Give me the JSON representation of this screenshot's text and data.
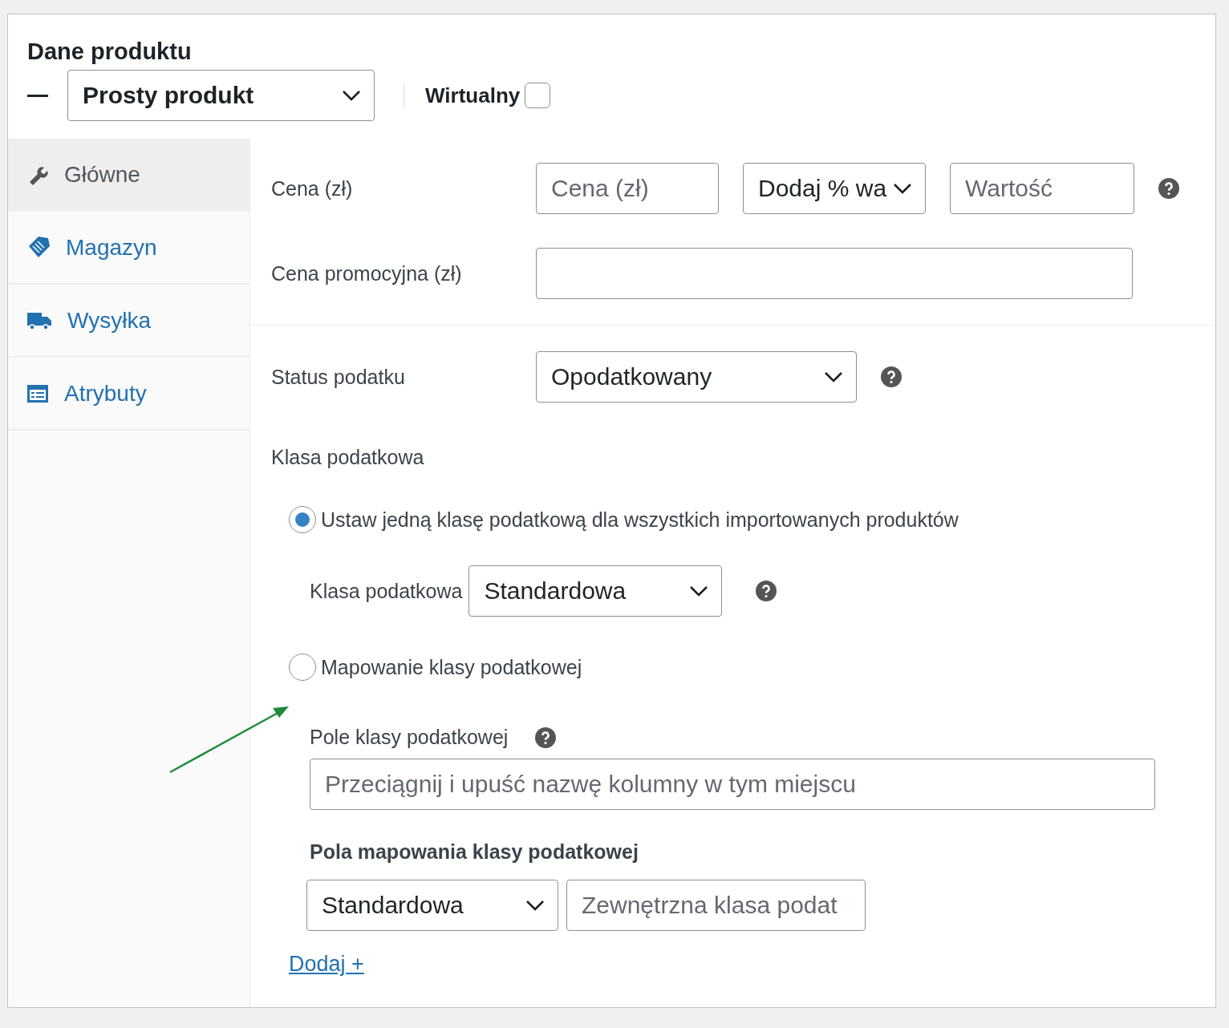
{
  "panel": {
    "title": "Dane produktu",
    "product_type": "Prosty produkt",
    "virtual": {
      "label": "Wirtualny",
      "checked": false
    }
  },
  "tabs": [
    {
      "label": "Główne",
      "selected": true
    },
    {
      "label": "Magazyn",
      "selected": false
    },
    {
      "label": "Wysyłka",
      "selected": false
    },
    {
      "label": "Atrybuty",
      "selected": false
    }
  ],
  "pricing": {
    "regular_label": "Cena (zł)",
    "regular_placeholder": "Cena (zł)",
    "adjust_select": "Dodaj % wa",
    "adjust_placeholder": "Wartość",
    "sale_label": "Cena promocyjna (zł)"
  },
  "tax": {
    "status_label": "Status podatku",
    "status_value": "Opodatkowany",
    "class_label": "Klasa podatkowa",
    "options": [
      {
        "label": "Ustaw jedną klasę podatkową dla wszystkich importowanych produktów",
        "selected": true
      },
      {
        "label": "Mapowanie klasy podatkowej",
        "selected": false
      }
    ],
    "single_class_label": "Klasa podatkowa",
    "single_class_value": "Standardowa",
    "field_label": "Pole klasy podatkowej",
    "field_placeholder": "Przeciągnij i upuść nazwę kolumny w tym miejscu",
    "mapping_title": "Pola mapowania klasy podatkowej",
    "mapping_rows": [
      {
        "class": "Standardowa",
        "placeholder": "Zewnętrzna klasa podat"
      }
    ],
    "add_link": "Dodaj +"
  }
}
